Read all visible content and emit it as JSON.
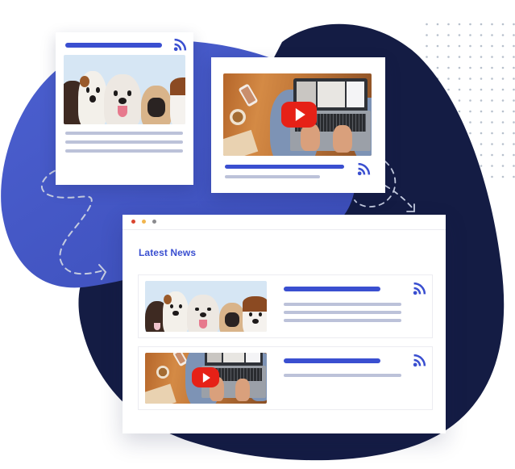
{
  "colors": {
    "accent_blue": "#3a4fd0",
    "blob_blue": "#4457c4",
    "blob_navy": "#141c44",
    "placeholder_grey": "#bcc2d9",
    "dot_red": "#d9452f",
    "dot_yellow": "#f1b54e",
    "dot_grey": "#8a8a8e",
    "play_red": "#e62117"
  },
  "icons": {
    "rss": "rss-feed-icon",
    "play": "youtube-play-icon",
    "arrow": "dashed-arrow-icon"
  },
  "feed_cards": [
    {
      "type": "image",
      "image": "puppies-photo",
      "placeholder_lines": 3
    },
    {
      "type": "video",
      "image": "laptop-video-conference-photo",
      "placeholder_lines": 2
    }
  ],
  "window": {
    "controls": [
      "close",
      "minimize",
      "maximize"
    ],
    "title": "Latest News",
    "items": [
      {
        "image": "puppies-photo",
        "type": "image",
        "placeholder_lines": 3
      },
      {
        "image": "laptop-video-conference-photo",
        "type": "video",
        "placeholder_lines": 1
      }
    ]
  }
}
